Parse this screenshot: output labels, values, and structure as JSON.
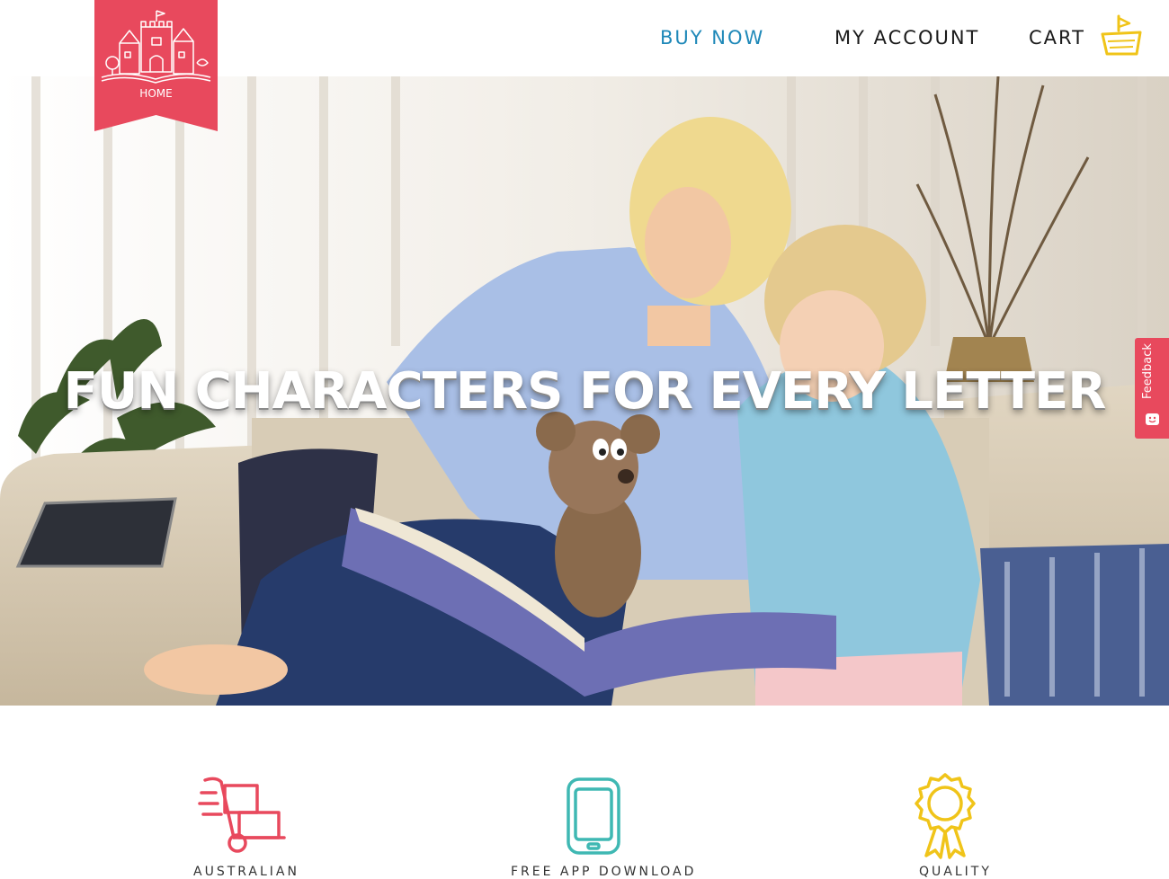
{
  "nav": {
    "home_label": "HOME",
    "buy_now": "BUY NOW",
    "my_account": "MY ACCOUNT",
    "cart": "CART"
  },
  "hero": {
    "title": "FUN CHARACTERS FOR EVERY LETTER"
  },
  "feedback": {
    "label": "Feedback"
  },
  "features": [
    {
      "icon": "hand-truck-icon",
      "label": "AUSTRALIAN"
    },
    {
      "icon": "tablet-icon",
      "label": "FREE APP DOWNLOAD"
    },
    {
      "icon": "award-ribbon-icon",
      "label": "QUALITY"
    }
  ],
  "colors": {
    "brand_red": "#e8495d",
    "link_blue": "#1e88b8",
    "teal": "#3fb8b3",
    "gold": "#f0c419"
  }
}
